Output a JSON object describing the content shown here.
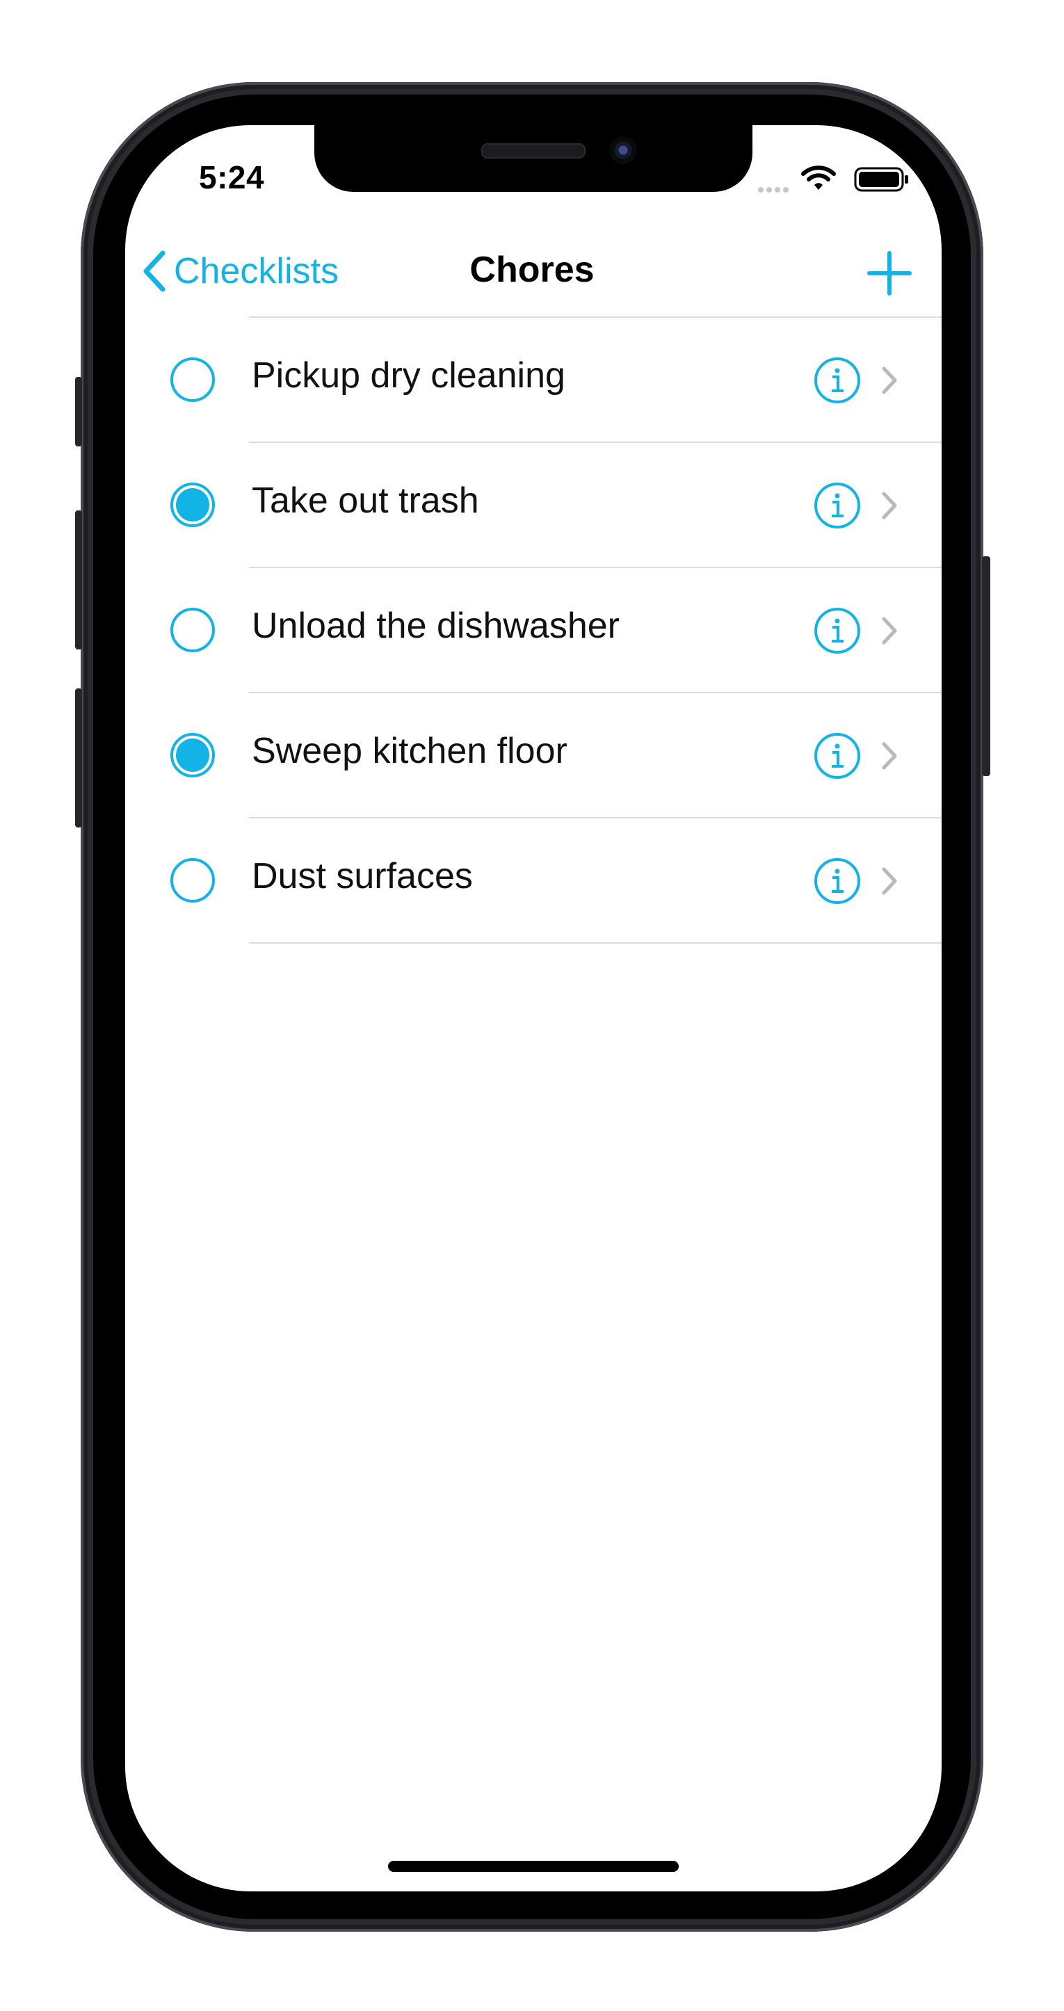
{
  "status_bar": {
    "time": "5:24",
    "icons": [
      "cellular-signal-icon",
      "wifi-icon",
      "battery-icon"
    ]
  },
  "nav": {
    "back_label": "Checklists",
    "title": "Chores",
    "add_icon": "plus-icon"
  },
  "colors": {
    "accent": "#13b3e6",
    "chevron": "#b8b8bd",
    "separator": "#dcdcdc"
  },
  "items": [
    {
      "label": "Pickup dry cleaning",
      "checked": false
    },
    {
      "label": "Take out trash",
      "checked": true
    },
    {
      "label": "Unload the dishwasher",
      "checked": false
    },
    {
      "label": "Sweep kitchen floor",
      "checked": true
    },
    {
      "label": "Dust surfaces",
      "checked": false
    }
  ]
}
